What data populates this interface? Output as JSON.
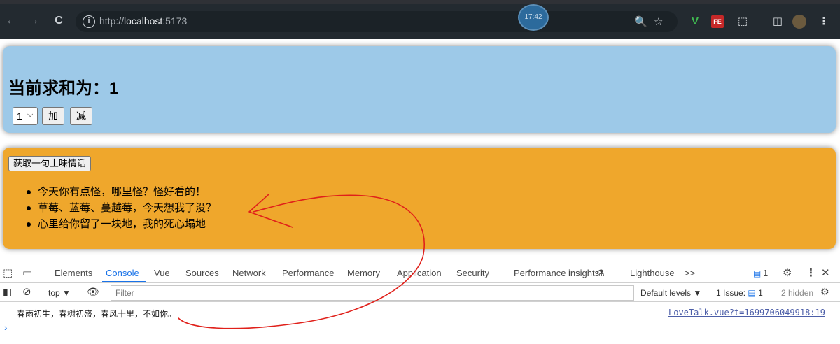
{
  "browser": {
    "url_host_prefix": "http://",
    "url_host": "localhost",
    "url_port": ":5173",
    "clock": "17:42",
    "back_icon": "←",
    "forward_icon": "→",
    "reload_icon": "C",
    "info_icon": "i",
    "zoom_icon": "🔍",
    "star_icon": "☆",
    "ext_v": "V",
    "ext_fe": "FE",
    "ext_puzzle": "⬚",
    "side_panel": "◫",
    "menu_icon": "⋮"
  },
  "sum_panel": {
    "title": "当前求和为：1",
    "select_value": "1",
    "select_caret": "⌵",
    "add_label": "加",
    "sub_label": "减"
  },
  "talk_panel": {
    "button_label": "获取一句土味情话",
    "items": [
      "今天你有点怪，哪里怪？怪好看的！",
      "草莓、蓝莓、蔓越莓，今天想我了没？",
      "心里给你留了一块地，我的死心塌地"
    ]
  },
  "devtools": {
    "tabs": [
      "Elements",
      "Console",
      "Vue",
      "Sources",
      "Network",
      "Performance",
      "Memory",
      "Application",
      "Security",
      "Performance insights",
      "Lighthouse"
    ],
    "more_tabs": ">>",
    "issue_badge": "1",
    "close_icon": "✕",
    "context": "top",
    "filter_placeholder": "Filter",
    "levels": "Default levels",
    "issues_label": "1 Issue:",
    "issues_count": "1",
    "hidden_label": "2 hidden",
    "log_message": "春雨初生，春树初盛，春风十里，不如你。",
    "log_source": "LoveTalk.vue?t=1699706049918:19",
    "prompt": "›"
  },
  "colors": {
    "sum_bg": "#9dc9e8",
    "talk_bg": "#efa72c",
    "annotation": "#e0201a"
  }
}
